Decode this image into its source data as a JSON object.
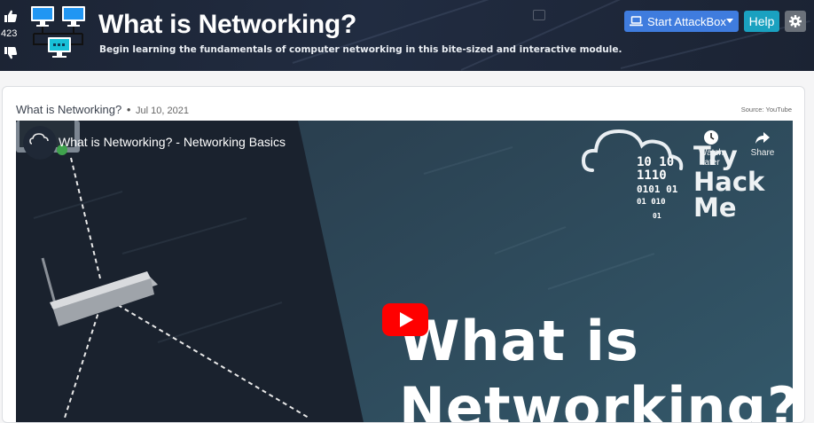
{
  "room": {
    "votes": "423",
    "title": "What is Networking?",
    "subtitle": "Begin learning the fundamentals of computer networking in this bite-sized and interactive module."
  },
  "toolbar": {
    "attackbox_label": "Start AttackBox",
    "help_label": "Help"
  },
  "card": {
    "heading": "What is Networking?",
    "separator": "•",
    "date": "Jul 10, 2021",
    "source": "Source: YouTube"
  },
  "video": {
    "title": "What is Networking? - Networking Basics",
    "watch_later": "Watch later",
    "share": "Share",
    "overlay_line1": "What is",
    "overlay_line2": "Networking?",
    "logo_line1": "Try",
    "logo_line2": "Hack",
    "logo_line3": "Me",
    "binary_rows": [
      "10  10",
      "1110",
      "0101 01",
      "01   010",
      "01"
    ]
  },
  "icons": {
    "upvote": "thumbs-up-icon",
    "downvote": "thumbs-down-icon",
    "room": "network-computers-icon",
    "attackbox": "laptop-icon",
    "settings": "gear-icon",
    "play": "youtube-play-icon",
    "watch_later": "clock-icon",
    "share": "share-arrow-icon"
  },
  "colors": {
    "header_bg": "#1f2a3c",
    "attackbox_button": "#3f7cde",
    "help_button": "#1aa1c0",
    "settings_button": "#6b717a",
    "youtube_red": "#ff0000",
    "video_panel": "#2e4a5a"
  }
}
